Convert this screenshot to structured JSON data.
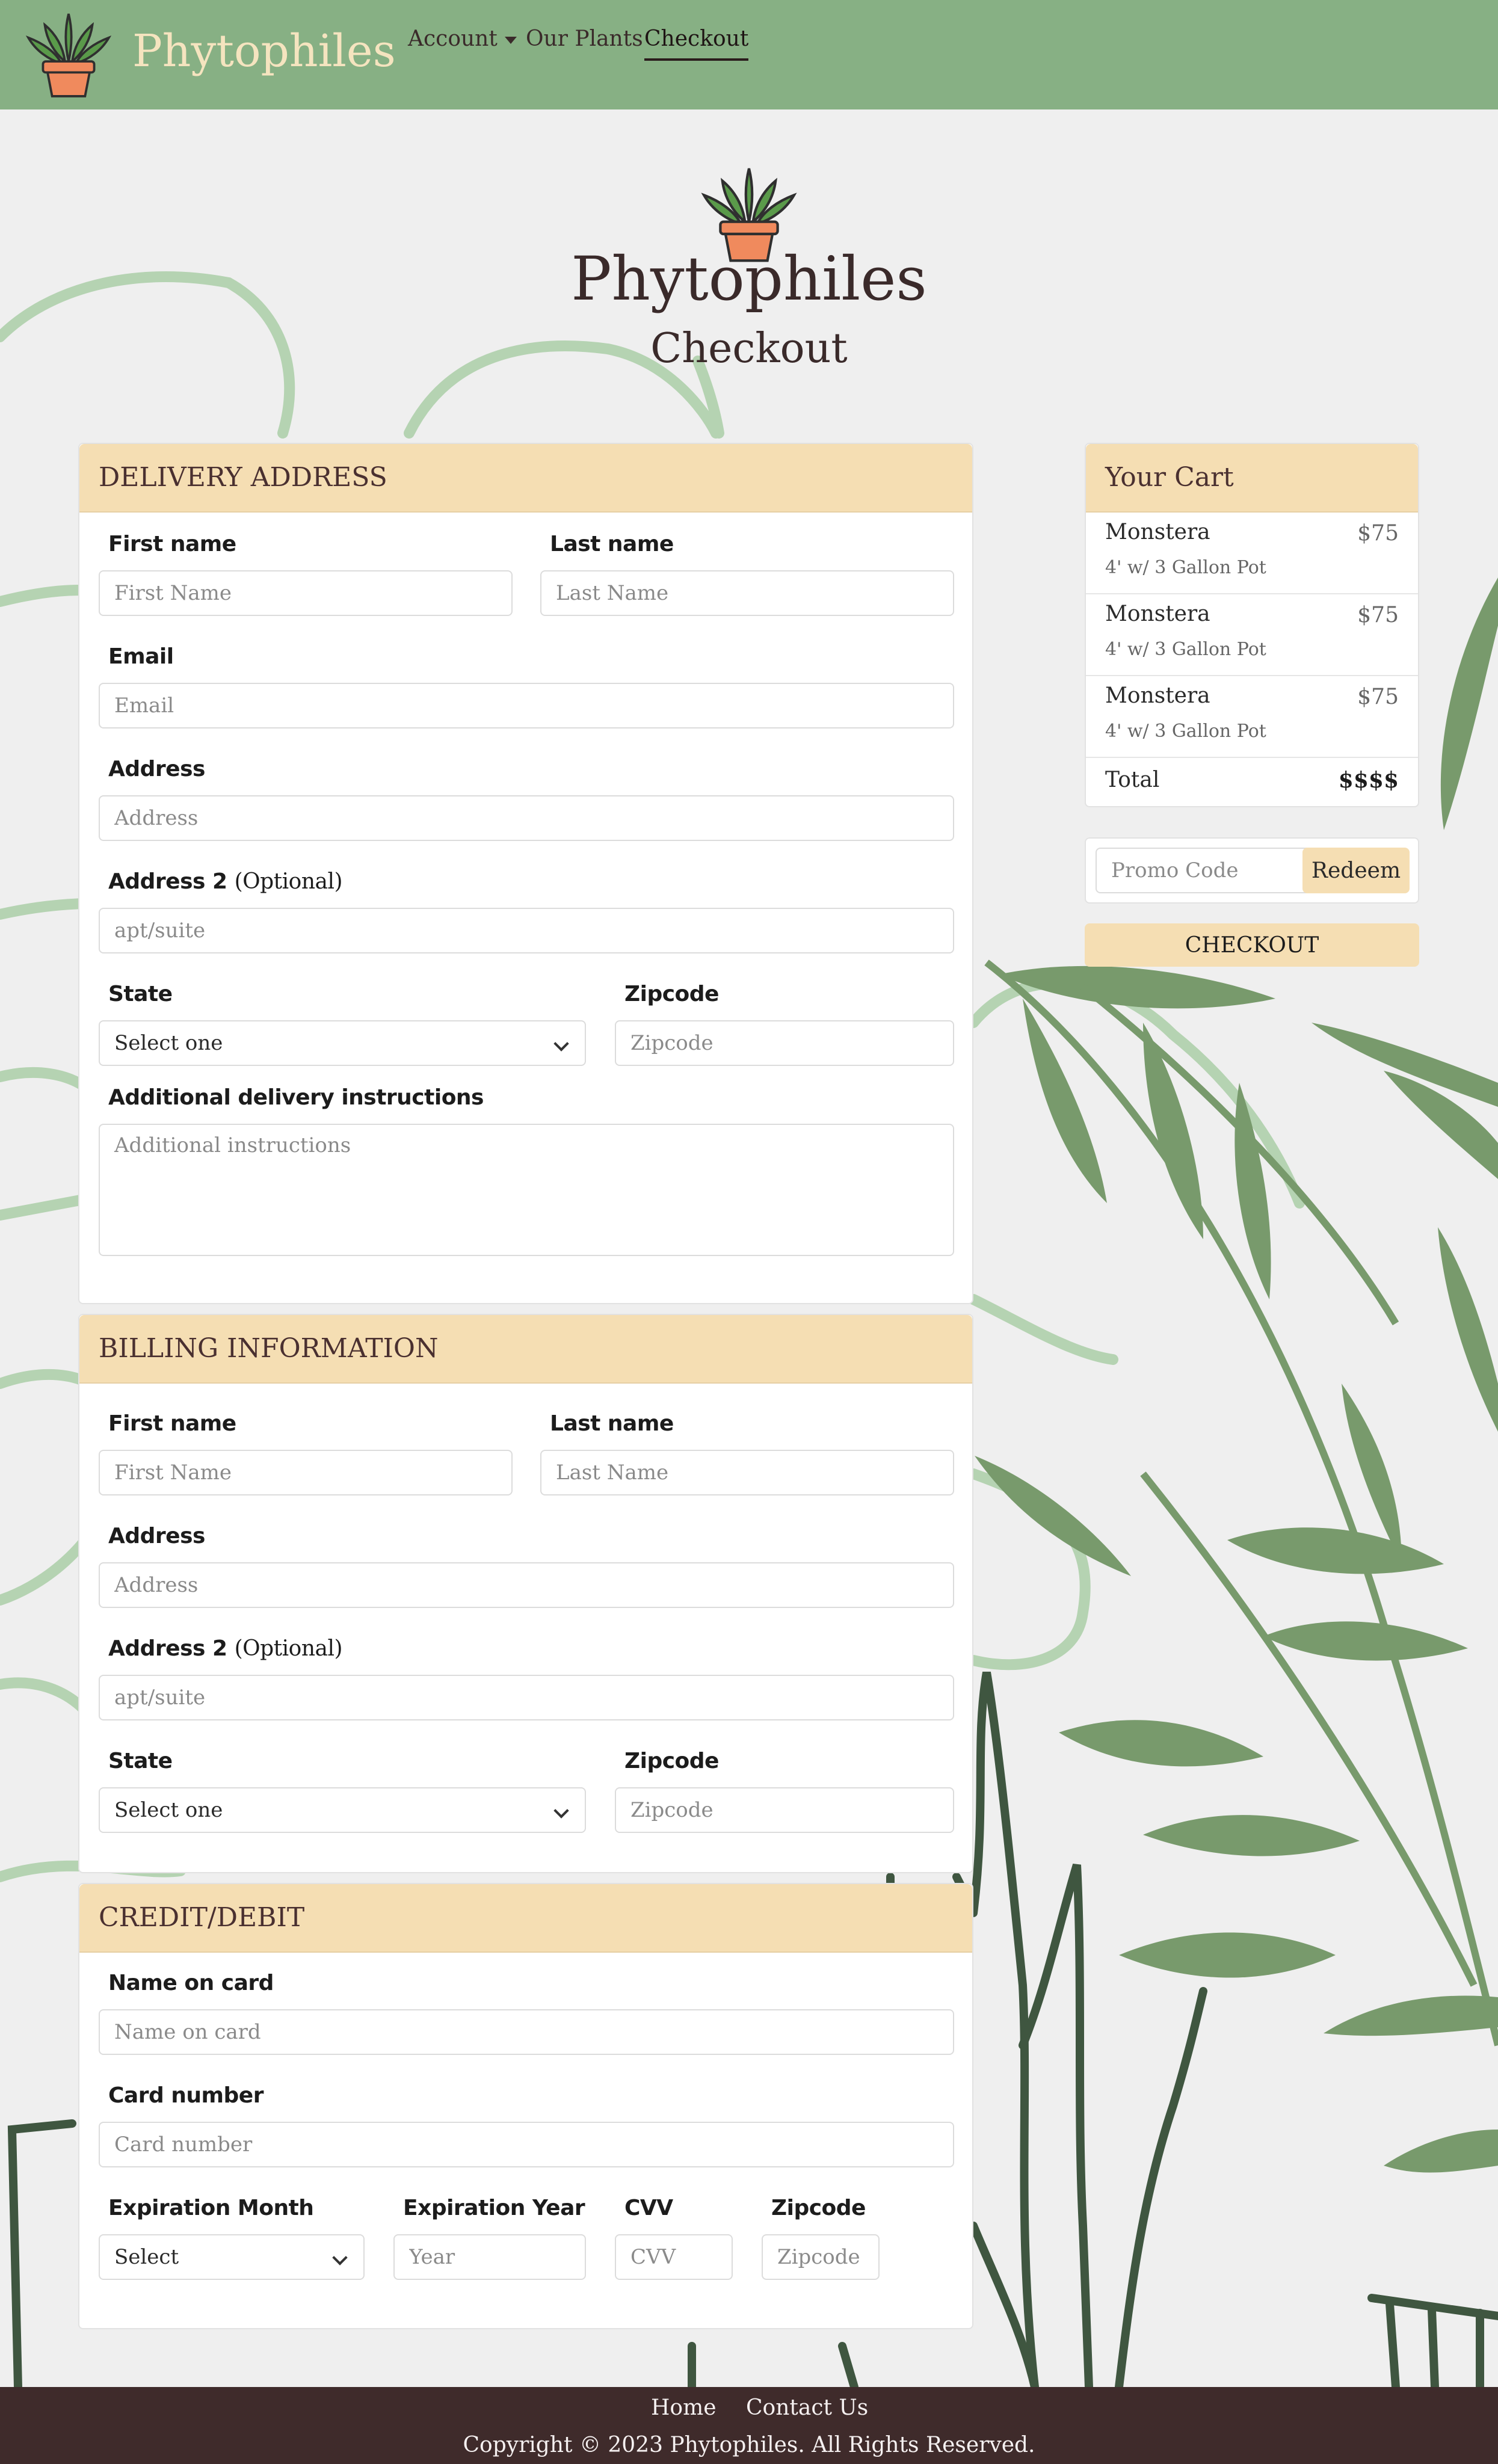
{
  "nav": {
    "brand": "Phytophiles",
    "account": "Account",
    "our_plants": "Our Plants",
    "checkout": "Checkout"
  },
  "hero": {
    "title": "Phytophiles",
    "subtitle": "Checkout"
  },
  "delivery": {
    "header": "DELIVERY ADDRESS",
    "first_name_label": "First name",
    "first_name_ph": "First Name",
    "last_name_label": "Last name",
    "last_name_ph": "Last Name",
    "email_label": "Email",
    "email_ph": "Email",
    "address_label": "Address",
    "address_ph": "Address",
    "address2_label": "Address 2",
    "address2_opt": "(Optional)",
    "address2_ph": "apt/suite",
    "state_label": "State",
    "state_value": "Select one",
    "zip_label": "Zipcode",
    "zip_ph": "Zipcode",
    "instructions_label": "Additional delivery instructions",
    "instructions_ph": "Additional instructions"
  },
  "billing": {
    "header": "BILLING INFORMATION",
    "first_name_label": "First name",
    "first_name_ph": "First Name",
    "last_name_label": "Last name",
    "last_name_ph": "Last Name",
    "address_label": "Address",
    "address_ph": "Address",
    "address2_label": "Address 2",
    "address2_opt": "(Optional)",
    "address2_ph": "apt/suite",
    "state_label": "State",
    "state_value": "Select one",
    "zip_label": "Zipcode",
    "zip_ph": "Zipcode"
  },
  "card": {
    "header": "CREDIT/DEBIT",
    "name_label": "Name on card",
    "name_ph": "Name on card",
    "number_label": "Card number",
    "number_ph": "Card number",
    "exp_month_label": "Expiration Month",
    "exp_month_value": "Select",
    "exp_year_label": "Expiration Year",
    "exp_year_ph": "Year",
    "cvv_label": "CVV",
    "cvv_ph": "CVV",
    "zip_label": "Zipcode",
    "zip_ph": "Zipcode"
  },
  "cart": {
    "header": "Your Cart",
    "items": [
      {
        "name": "Monstera",
        "desc": "4' w/ 3 Gallon Pot",
        "price": "$75"
      },
      {
        "name": "Monstera",
        "desc": "4' w/ 3 Gallon Pot",
        "price": "$75"
      },
      {
        "name": "Monstera",
        "desc": "4' w/ 3 Gallon Pot",
        "price": "$75"
      }
    ],
    "total_label": "Total",
    "total_value": "$$$$",
    "promo_ph": "Promo Code",
    "redeem": "Redeem",
    "checkout": "CHECKOUT"
  },
  "footer": {
    "home": "Home",
    "contact": "Contact Us",
    "copyright": "Copyright © 2023 Phytophiles. All Rights Reserved."
  },
  "colors": {
    "navbar": "#87b084",
    "card_header": "#f5deb3",
    "footer": "#3f2b2b",
    "brand_text": "#f5e4bf",
    "background": "#efefef",
    "leaf_light": "#b5d3b2",
    "leaf_mid": "#789a6c",
    "leaf_dark": "#3f5640"
  }
}
